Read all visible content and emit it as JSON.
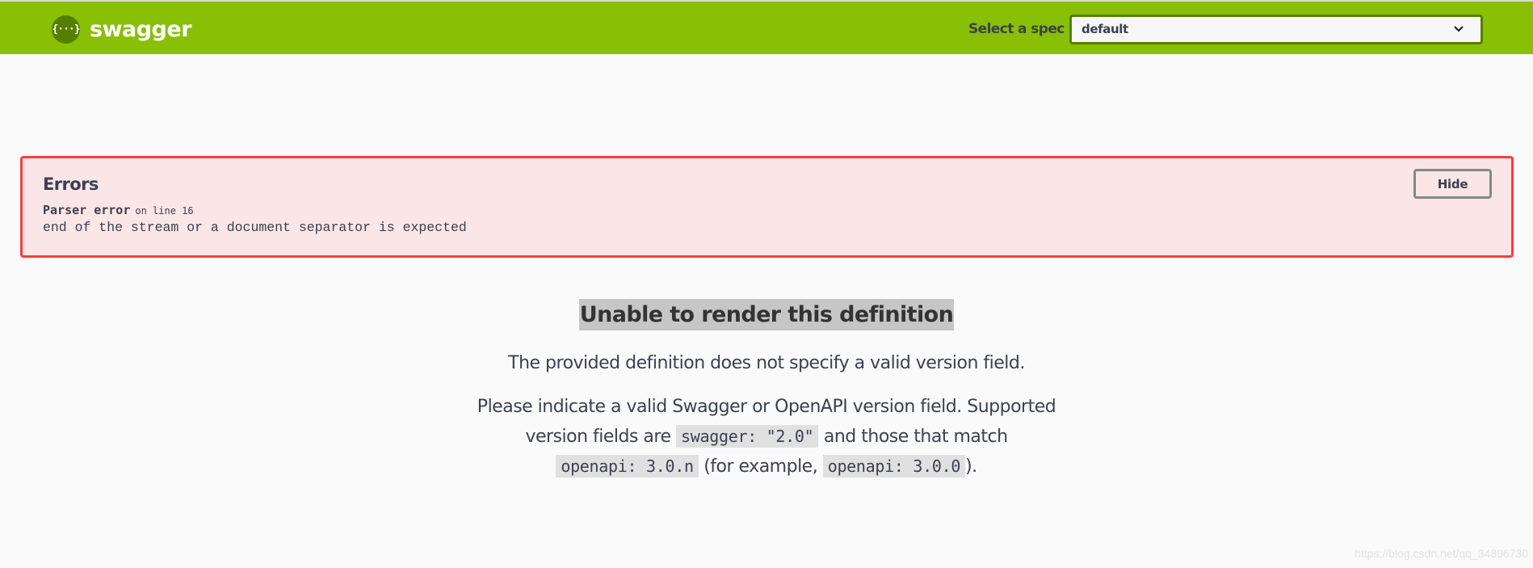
{
  "topbar": {
    "brand_text": "swagger",
    "logo_glyph": "{···}",
    "logo_icon": "swagger-logo-icon",
    "spec_label": "Select a spec",
    "spec_selected": "default",
    "spec_chevron_icon": "chevron-down-icon",
    "colors": {
      "bar": "#89bf04",
      "logo_circle": "#547f00"
    }
  },
  "errors": {
    "title": "Errors",
    "items": [
      {
        "source": "Parser error",
        "location": "on line 16",
        "message": "end of the stream or a document separator is expected"
      }
    ],
    "hide_label": "Hide",
    "colors": {
      "border": "#f93e3e",
      "background": "#fae6e6"
    }
  },
  "render_error": {
    "title": "Unable to render this definition",
    "paragraph1": "The provided definition does not specify a valid version field.",
    "paragraph2": {
      "text_a": "Please indicate a valid Swagger or OpenAPI version field. Supported version fields are ",
      "code_a": "swagger: \"2.0\"",
      "text_b": " and those that match ",
      "code_b": "openapi: 3.0.n",
      "text_c": " (for example, ",
      "code_c": "openapi: 3.0.0",
      "text_d": ")."
    }
  },
  "watermark": "https://blog.csdn.net/qq_34896730"
}
